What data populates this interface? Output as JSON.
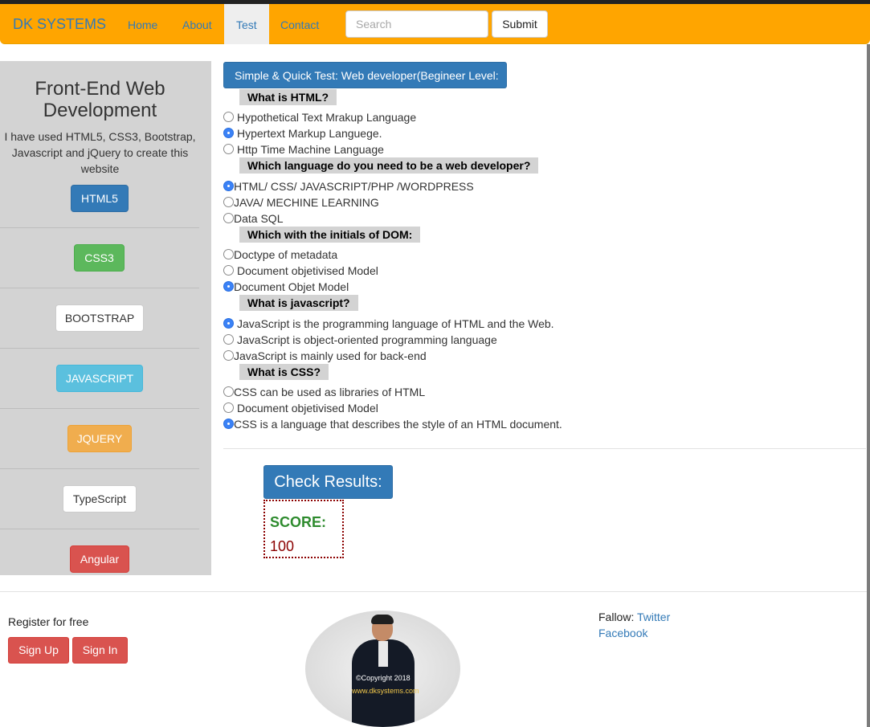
{
  "navbar": {
    "brand": "DK SYSTEMS",
    "links": [
      {
        "label": "Home",
        "active": false
      },
      {
        "label": "About",
        "active": false
      },
      {
        "label": "Test",
        "active": true
      },
      {
        "label": "Contact",
        "active": false
      }
    ],
    "search_placeholder": "Search",
    "submit_label": "Submit",
    "color": "#ffa500"
  },
  "sidebar": {
    "title": "Front-End Web Development",
    "description": "I have used HTML5, CSS3, Bootstrap, Javascript and jQuery to create this website",
    "buttons": [
      {
        "label": "HTML5",
        "style": "primary"
      },
      {
        "label": "CSS3",
        "style": "success"
      },
      {
        "label": "BOOTSTRAP",
        "style": "default"
      },
      {
        "label": "JAVASCRIPT",
        "style": "info"
      },
      {
        "label": "JQUERY",
        "style": "warning"
      },
      {
        "label": "TypeScript",
        "style": "default"
      },
      {
        "label": "Angular",
        "style": "danger"
      }
    ]
  },
  "test": {
    "title": "Simple & Quick Test: Web developer(Begineer Level:",
    "questions": [
      {
        "question": "What is HTML?",
        "options": [
          {
            "label": "Hypothetical Text Mrakup Language",
            "checked": false
          },
          {
            "label": "Hypertext Markup Languege.",
            "checked": true
          },
          {
            "label": "Http Time Machine Language",
            "checked": false
          }
        ]
      },
      {
        "question": "Which language do you need to be a web developer?",
        "options": [
          {
            "label": "HTML/ CSS/ JAVASCRIPT/PHP /WORDPRESS",
            "checked": true
          },
          {
            "label": "JAVA/ MECHINE LEARNING",
            "checked": false
          },
          {
            "label": "Data SQL",
            "checked": false
          }
        ]
      },
      {
        "question": "Which with the initials of DOM:",
        "options": [
          {
            "label": "Doctype of metadata",
            "checked": false
          },
          {
            "label": "Document objetivised Model",
            "checked": false
          },
          {
            "label": "Document Objet Model",
            "checked": true
          }
        ]
      },
      {
        "question": "What is javascript?",
        "options": [
          {
            "label": "JavaScript is the programming language of HTML and the Web.",
            "checked": true
          },
          {
            "label": "JavaScript is object-oriented programming language",
            "checked": false
          },
          {
            "label": "JavaScript is mainly used for back-end",
            "checked": false
          }
        ]
      },
      {
        "question": "What is CSS?",
        "options": [
          {
            "label": "CSS can be used as libraries of HTML",
            "checked": false
          },
          {
            "label": "Document objetivised Model",
            "checked": false
          },
          {
            "label": "CSS is a language that describes the style of an HTML document.",
            "checked": true
          }
        ]
      }
    ],
    "check_button": "Check Results:",
    "score_label": "SCORE:",
    "score_value": "100"
  },
  "footer": {
    "register_text": "Register for free",
    "signup_label": "Sign Up",
    "signin_label": "Sign In",
    "photo_copyright": "©Copyright  2018",
    "photo_url": "www.dksystems.com",
    "follow_text": "Fallow:",
    "twitter_label": "Twitter",
    "facebook_label": "Facebook"
  }
}
